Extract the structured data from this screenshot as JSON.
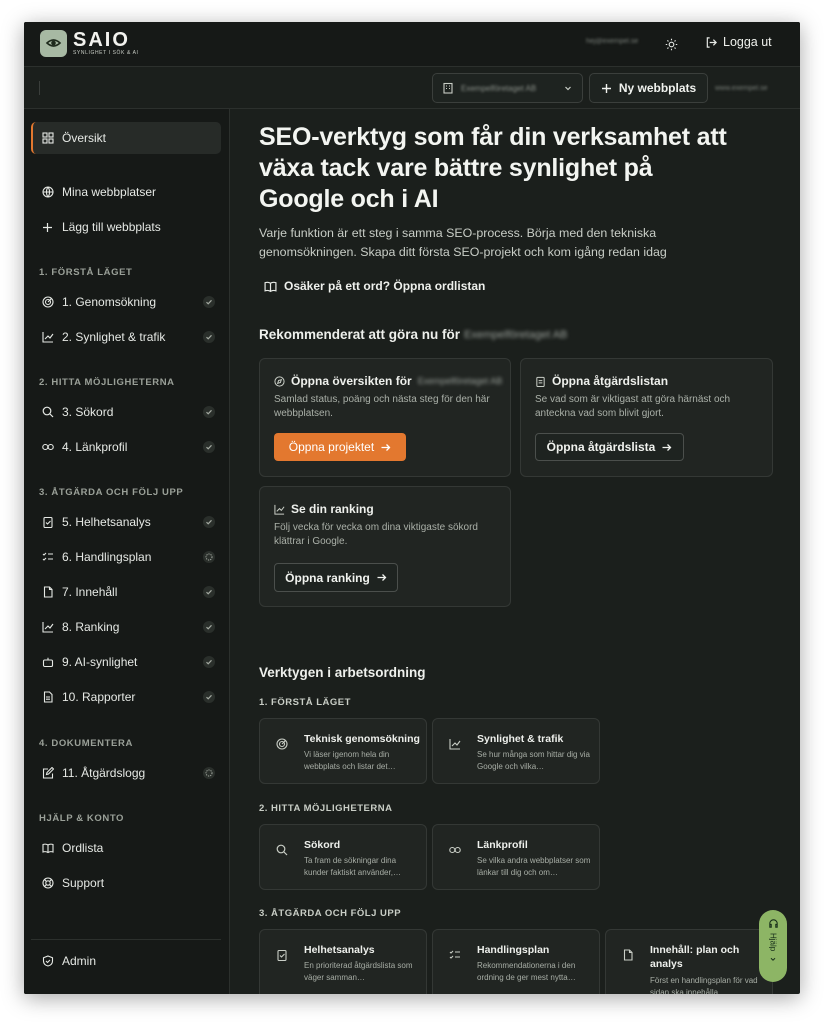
{
  "header": {
    "brand_name": "SAIO",
    "brand_tagline": "SYNLIGHET I SÖK & AI",
    "user_email": "hej@exempel.se",
    "logout_label": "Logga ut"
  },
  "subbar": {
    "site_select_value": "Exempelföretaget AB",
    "new_site_label": "Ny webbplats",
    "site_url": "www.exempel.se"
  },
  "sidebar": {
    "overview": "Översikt",
    "my_sites": "Mina webbplatser",
    "add_site": "Lägg till webbplats",
    "sections": [
      "1. FÖRSTÅ LÄGET",
      "2. HITTA MÖJLIGHETERNA",
      "3. ÅTGÄRDA OCH FÖLJ UPP",
      "4. DOKUMENTERA",
      "HJÄLP & KONTO"
    ],
    "steps": [
      {
        "label": "1. Genomsökning",
        "status": "done"
      },
      {
        "label": "2. Synlighet & trafik",
        "status": "done"
      },
      {
        "label": "3. Sökord",
        "status": "done"
      },
      {
        "label": "4. Länkprofil",
        "status": "done"
      },
      {
        "label": "5. Helhetsanalys",
        "status": "done"
      },
      {
        "label": "6. Handlingsplan",
        "status": "pending"
      },
      {
        "label": "7. Innehåll",
        "status": "done"
      },
      {
        "label": "8. Ranking",
        "status": "done"
      },
      {
        "label": "9. AI-synlighet",
        "status": "done"
      },
      {
        "label": "10. Rapporter",
        "status": "done"
      },
      {
        "label": "11. Åtgärdslogg",
        "status": "pending"
      }
    ],
    "glossary": "Ordlista",
    "support": "Support",
    "admin": "Admin"
  },
  "main": {
    "hero_title": "SEO-verktyg som får din verksamhet att växa tack vare bättre synlighet på Google och i AI",
    "hero_sub": "Varje funktion är ett steg i samma SEO-process. Börja med den tekniska genomsökningen. Skapa ditt första SEO-projekt och kom igång redan idag",
    "glossary_link": "Osäker på ett ord? Öppna ordlistan",
    "recommended_title": "Rekommenderat att göra nu för",
    "recommended_site": "Exempelföretaget AB",
    "cards": {
      "overview_title": "Öppna översikten för",
      "overview_site": "Exempelföretaget AB",
      "overview_desc": "Samlad status, poäng och nästa steg för den här webbplatsen.",
      "overview_btn": "Öppna projektet",
      "actions_title": "Öppna åtgärdslistan",
      "actions_desc": "Se vad som är viktigast att göra härnäst och anteckna vad som blivit gjort.",
      "actions_btn": "Öppna åtgärdslista",
      "ranking_title": "Se din ranking",
      "ranking_desc": "Följ vecka för vecka om dina viktigaste sökord klättrar i Google.",
      "ranking_btn": "Öppna ranking"
    },
    "tools_title": "Verktygen i arbetsordning",
    "tool_sections": [
      "1. FÖRSTÅ LÄGET",
      "2. HITTA MÖJLIGHETERNA",
      "3. ÅTGÄRDA OCH FÖLJ UPP"
    ],
    "tools": [
      {
        "title": "Teknisk genomsökning",
        "desc": "Vi läser igenom hela din webbplats och listar det…",
        "icon": "radar-icon"
      },
      {
        "title": "Synlighet & trafik",
        "desc": "Se hur många som hittar dig via Google och vilka…",
        "icon": "line-chart-icon"
      },
      {
        "title": "Sökord",
        "desc": "Ta fram de sökningar dina kunder faktiskt använder,…",
        "icon": "search-icon"
      },
      {
        "title": "Länkprofil",
        "desc": "Se vilka andra webbplatser som länkar till dig och om…",
        "icon": "link-icon"
      },
      {
        "title": "Helhetsanalys",
        "desc": "En prioriterad åtgärdslista som väger samman…",
        "icon": "clipboard-check-icon"
      },
      {
        "title": "Handlingsplan",
        "desc": "Rekommendationerna i den ordning de ger mest nytta…",
        "icon": "list-check-icon"
      },
      {
        "title": "Innehåll: plan och analys",
        "desc": "Först en handlingsplan för vad sidan ska innehålla,…",
        "icon": "file-icon"
      }
    ]
  },
  "help_label": "Hjälp",
  "colors": {
    "accent": "#e3782f",
    "background": "#1b1f1c",
    "panel": "#212522",
    "help": "#8db565"
  }
}
